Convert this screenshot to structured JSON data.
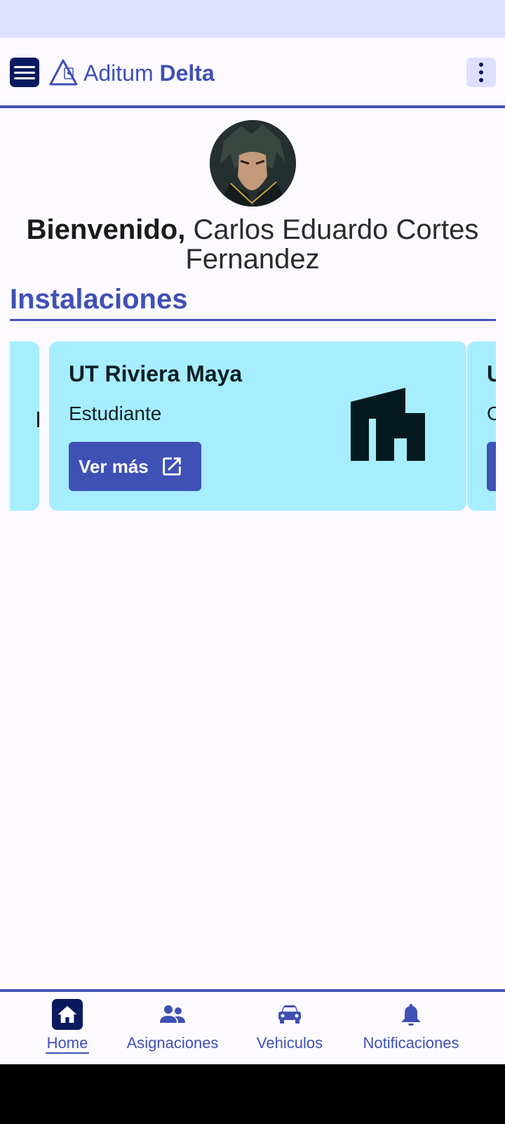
{
  "app": {
    "brand_light": "Aditum",
    "brand_bold": "Delta"
  },
  "colors": {
    "primary": "#3f51b5",
    "primary_dark": "#0a1a5e",
    "card_bg": "#a6eeff",
    "background": "#fcf9ff",
    "status_bar": "#dfe0ff"
  },
  "welcome": {
    "greeting": "Bienvenido,",
    "name": "Carlos Eduardo Cortes Fernandez"
  },
  "section": {
    "title": "Instalaciones"
  },
  "cards": [
    {
      "title": "UT Riviera Maya",
      "role": "Estudiante",
      "button_label": "Ver más",
      "icon": "home-work-icon"
    }
  ],
  "next_card_peek": {
    "title_first_char": "U",
    "role_first_char": "C"
  },
  "bottom_nav": [
    {
      "label": "Home",
      "icon": "home-icon",
      "active": true
    },
    {
      "label": "Asignaciones",
      "icon": "people-icon",
      "active": false
    },
    {
      "label": "Vehiculos",
      "icon": "car-icon",
      "active": false
    },
    {
      "label": "Notificaciones",
      "icon": "bell-icon",
      "active": false
    }
  ]
}
